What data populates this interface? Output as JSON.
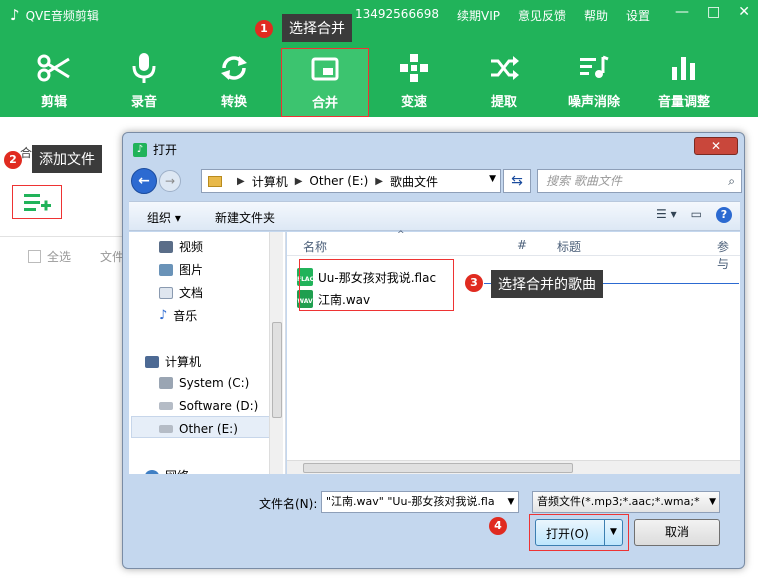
{
  "app": {
    "title": "QVE音频剪辑",
    "phone": "13492566698",
    "links": [
      "续期VIP",
      "意见反馈",
      "帮助",
      "设置"
    ],
    "win_controls": [
      "—",
      "□",
      "✕"
    ]
  },
  "toolbar": [
    {
      "label": "剪辑",
      "icon": "scissors-icon"
    },
    {
      "label": "录音",
      "icon": "microphone-icon"
    },
    {
      "label": "转换",
      "icon": "convert-icon"
    },
    {
      "label": "合并",
      "icon": "merge-icon",
      "active": true
    },
    {
      "label": "变速",
      "icon": "speed-icon"
    },
    {
      "label": "提取",
      "icon": "extract-icon"
    },
    {
      "label": "噪声消除",
      "icon": "noise-icon"
    },
    {
      "label": "音量调整",
      "icon": "volume-icon"
    }
  ],
  "callouts": [
    {
      "num": "1",
      "text": "选择合并"
    },
    {
      "num": "2",
      "text": "添加文件"
    },
    {
      "num": "3",
      "text": "选择合并的歌曲"
    },
    {
      "num": "4",
      "text": ""
    }
  ],
  "main": {
    "output_format_label": "合并输出格式",
    "select_all": "全选",
    "file_col": "文件"
  },
  "dialog": {
    "title": "打开",
    "close": "✕",
    "address": [
      "计算机",
      "Other (E:)",
      "歌曲文件"
    ],
    "search_placeholder": "搜索 歌曲文件",
    "organize": "组织 ▾",
    "new_folder": "新建文件夹",
    "nav": [
      {
        "label": "视频"
      },
      {
        "label": "图片"
      },
      {
        "label": "文档"
      },
      {
        "label": "音乐"
      },
      {
        "label": "计算机"
      },
      {
        "label": "System (C:)"
      },
      {
        "label": "Software (D:)"
      },
      {
        "label": "Other (E:)"
      },
      {
        "label": "网络"
      }
    ],
    "columns": [
      "名称",
      "#",
      "标题",
      "参与"
    ],
    "files": [
      {
        "name": "Uu-那女孩对我说.flac",
        "badge": "FLAC"
      },
      {
        "name": "江南.wav",
        "badge": "WAV"
      }
    ],
    "filename_label": "文件名(N):",
    "filename_value": "\"江南.wav\" \"Uu-那女孩对我说.fla",
    "filetype_value": "音频文件(*.mp3;*.aac;*.wma;*",
    "open_label": "打开(O)",
    "cancel_label": "取消"
  }
}
